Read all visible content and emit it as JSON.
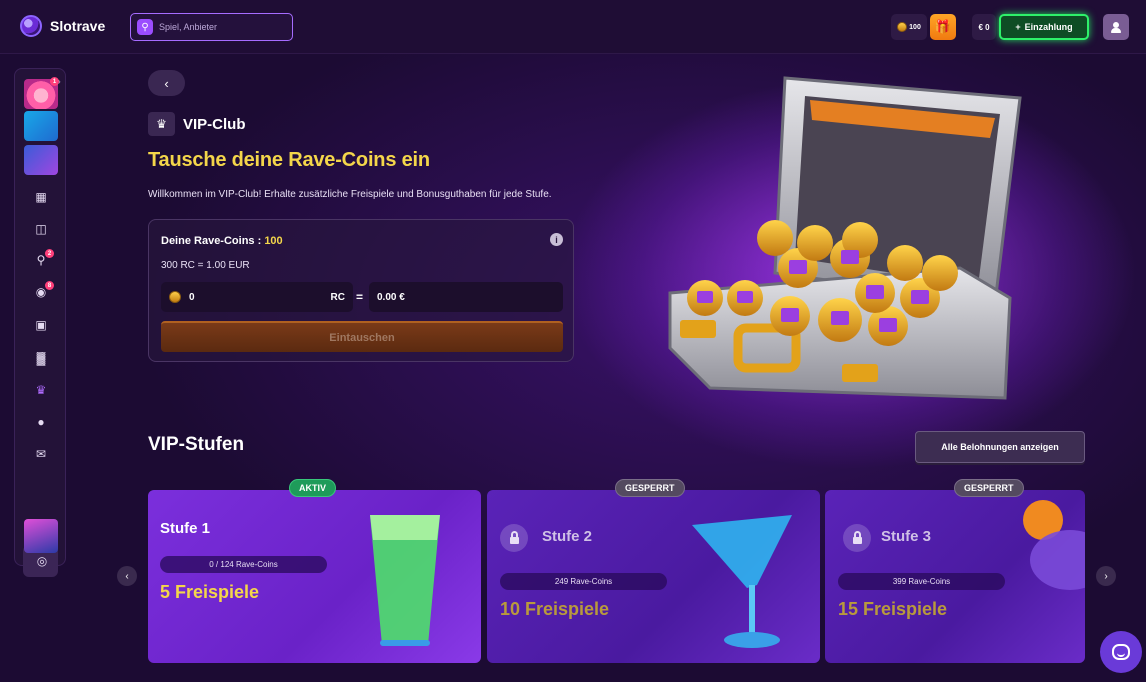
{
  "header": {
    "logo_text": "Slotrave",
    "search_placeholder": "Spiel, Anbieter",
    "coins": "100",
    "balance": "€ 0",
    "deposit_label": "Einzahlung"
  },
  "sidebar": {
    "badges": {
      "trophy": "2",
      "bonus": "8",
      "top_game": "1"
    }
  },
  "vip": {
    "section_label": "VIP-Club",
    "headline": "Tausche deine Rave-Coins ein",
    "intro": "Willkommen im VIP-Club! Erhalte zusätzliche Freispiele und Bonusguthaben für jede Stufe."
  },
  "exchange": {
    "title": "Deine Rave-Coins :",
    "coins_value": "100",
    "rate": "300 RC = 1.00 EUR",
    "rc_value": "0",
    "rc_unit": "RC",
    "equals": "=",
    "eur_value": "0.00 €",
    "button_label": "Eintauschen"
  },
  "levels": {
    "title": "VIP-Stufen",
    "rewards_button": "Alle Belohnungen anzeigen",
    "cards": [
      {
        "badge": "AKTIV",
        "name": "Stufe 1",
        "progress": "0 / 124 Rave-Coins",
        "prize": "5 Freispiele",
        "locked": false
      },
      {
        "badge": "GESPERRT",
        "name": "Stufe 2",
        "progress": "249 Rave-Coins",
        "prize": "10 Freispiele",
        "locked": true
      },
      {
        "badge": "GESPERRT",
        "name": "Stufe 3",
        "progress": "399 Rave-Coins",
        "prize": "15 Freispiele",
        "locked": true
      }
    ]
  },
  "colors": {
    "accent_yellow": "#f4d64a",
    "deposit_green": "#2ef06a",
    "purple_card": "#7b2fdc",
    "active_badge": "#1e9b5a"
  }
}
